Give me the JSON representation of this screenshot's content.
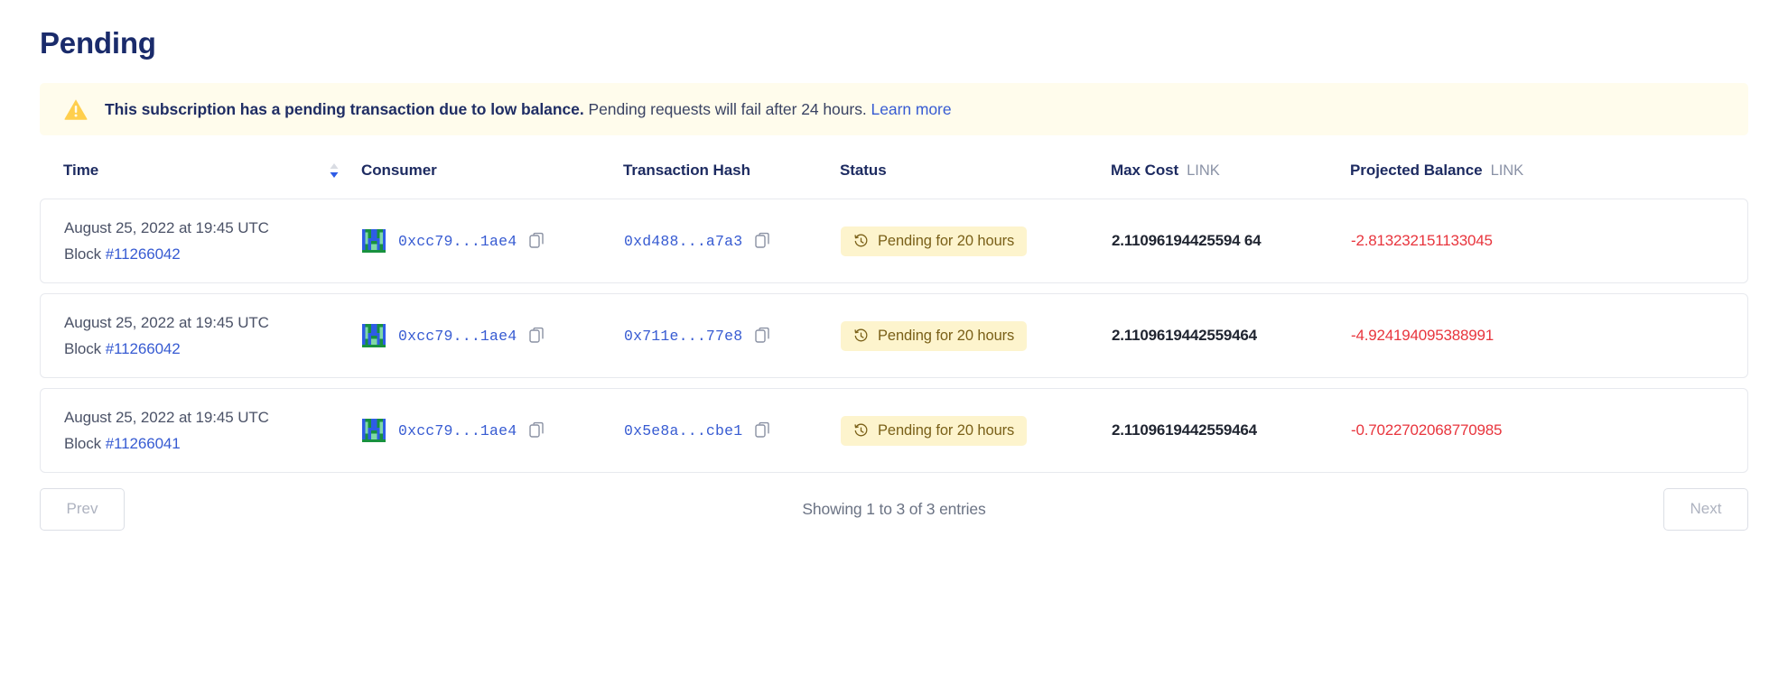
{
  "page": {
    "title": "Pending"
  },
  "banner": {
    "icon": "warning-triangle-icon",
    "message_bold": "This subscription has a pending transaction due to low balance.",
    "message_rest": "Pending requests will fail after 24 hours.",
    "link_label": "Learn more",
    "bg_color": "#fffcec",
    "icon_color": "#ffcf4d"
  },
  "table": {
    "columns": [
      {
        "label": "Time",
        "unit": "",
        "sortable": true,
        "sort_direction": "desc"
      },
      {
        "label": "Consumer",
        "unit": "",
        "sortable": false
      },
      {
        "label": "Transaction Hash",
        "unit": "",
        "sortable": false
      },
      {
        "label": "Status",
        "unit": "",
        "sortable": false
      },
      {
        "label": "Max Cost",
        "unit": "LINK",
        "sortable": false
      },
      {
        "label": "Projected Balance",
        "unit": "LINK",
        "sortable": false
      }
    ],
    "rows": [
      {
        "time": "August 25, 2022 at 19:45 UTC",
        "block_label": "Block",
        "block_number": "#11266042",
        "consumer": "0xcc79...1ae4",
        "tx_hash": "0xd488...a7a3",
        "status": "Pending for 20 hours",
        "max_cost": "2.11096194425594 64",
        "projected_balance": "-2.813232151133045"
      },
      {
        "time": "August 25, 2022 at 19:45 UTC",
        "block_label": "Block",
        "block_number": "#11266042",
        "consumer": "0xcc79...1ae4",
        "tx_hash": "0x711e...77e8",
        "status": "Pending for 20 hours",
        "max_cost": "2.1109619442559464",
        "projected_balance": "-4.924194095388991"
      },
      {
        "time": "August 25, 2022 at 19:45 UTC",
        "block_label": "Block",
        "block_number": "#11266041",
        "consumer": "0xcc79...1ae4",
        "tx_hash": "0x5e8a...cbe1",
        "status": "Pending for 20 hours",
        "max_cost": "2.1109619442559464",
        "projected_balance": "-0.7022702068770985"
      }
    ],
    "row_icons": {
      "consumer_avatar": "identicon-avatar",
      "copy_consumer": "copy-icon",
      "copy_hash": "copy-icon",
      "status": "clock-icon"
    },
    "colors": {
      "header_text": "#1d2b61",
      "link": "#375bd2",
      "negative": "#e8353d",
      "status_bg": "#fdf4cd",
      "status_text": "#7a6018"
    }
  },
  "pagination": {
    "prev_label": "Prev",
    "next_label": "Next",
    "summary": "Showing 1 to 3 of 3 entries"
  }
}
